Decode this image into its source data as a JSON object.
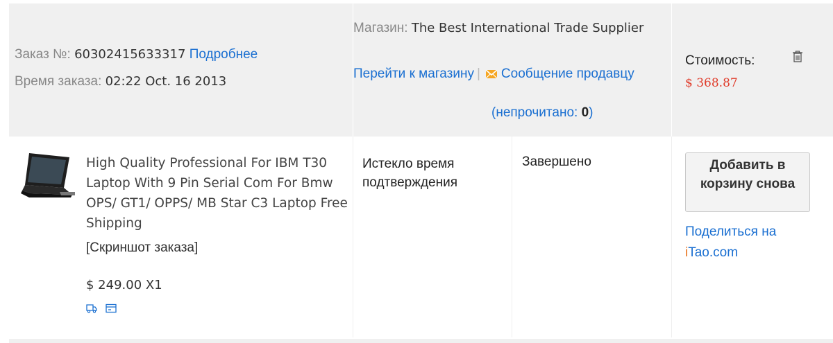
{
  "order": {
    "number_label": "Заказ №:",
    "number": "60302415633317",
    "details_link": "Подробнее",
    "time_label": "Время заказа:",
    "time": "02:22 Oct. 16 2013"
  },
  "store": {
    "label": "Магазин:",
    "name": "The Best International Trade Supplier",
    "goto_link": "Перейти к магазину",
    "separator": "|",
    "message_link": "Сообщение продавцу",
    "unread_label": "(непрочитано: ",
    "unread_count": "0",
    "unread_close": ")"
  },
  "cost": {
    "label": "Стоимость:",
    "value": "$ 368.87"
  },
  "item": {
    "title": "High Quality Professional For IBM T30 Laptop With 9 Pin Serial Com For Bmw OPS/ GT1/ OPPS/ MB Star C3 Laptop Free Shipping",
    "screenshot_link": "[Скриншот заказа]",
    "price_qty": "$ 249.00 X1",
    "status_confirm": "Истекло время подтверждения",
    "status_order": "Завершено"
  },
  "actions": {
    "readd_button": "Добавить в корзину снова",
    "share_label": "Поделиться на",
    "itao_i": "i",
    "itao_t": "Tao",
    "itao_dot": ".com"
  },
  "icons": [
    "trash-icon",
    "envelope-icon",
    "delivery-icon",
    "card-icon",
    "laptop-thumbnail"
  ],
  "colors": {
    "link": "#1a6fd1",
    "price": "#e03c2b",
    "header_bg": "#f0f0f0",
    "envelope": "#f5a623"
  }
}
